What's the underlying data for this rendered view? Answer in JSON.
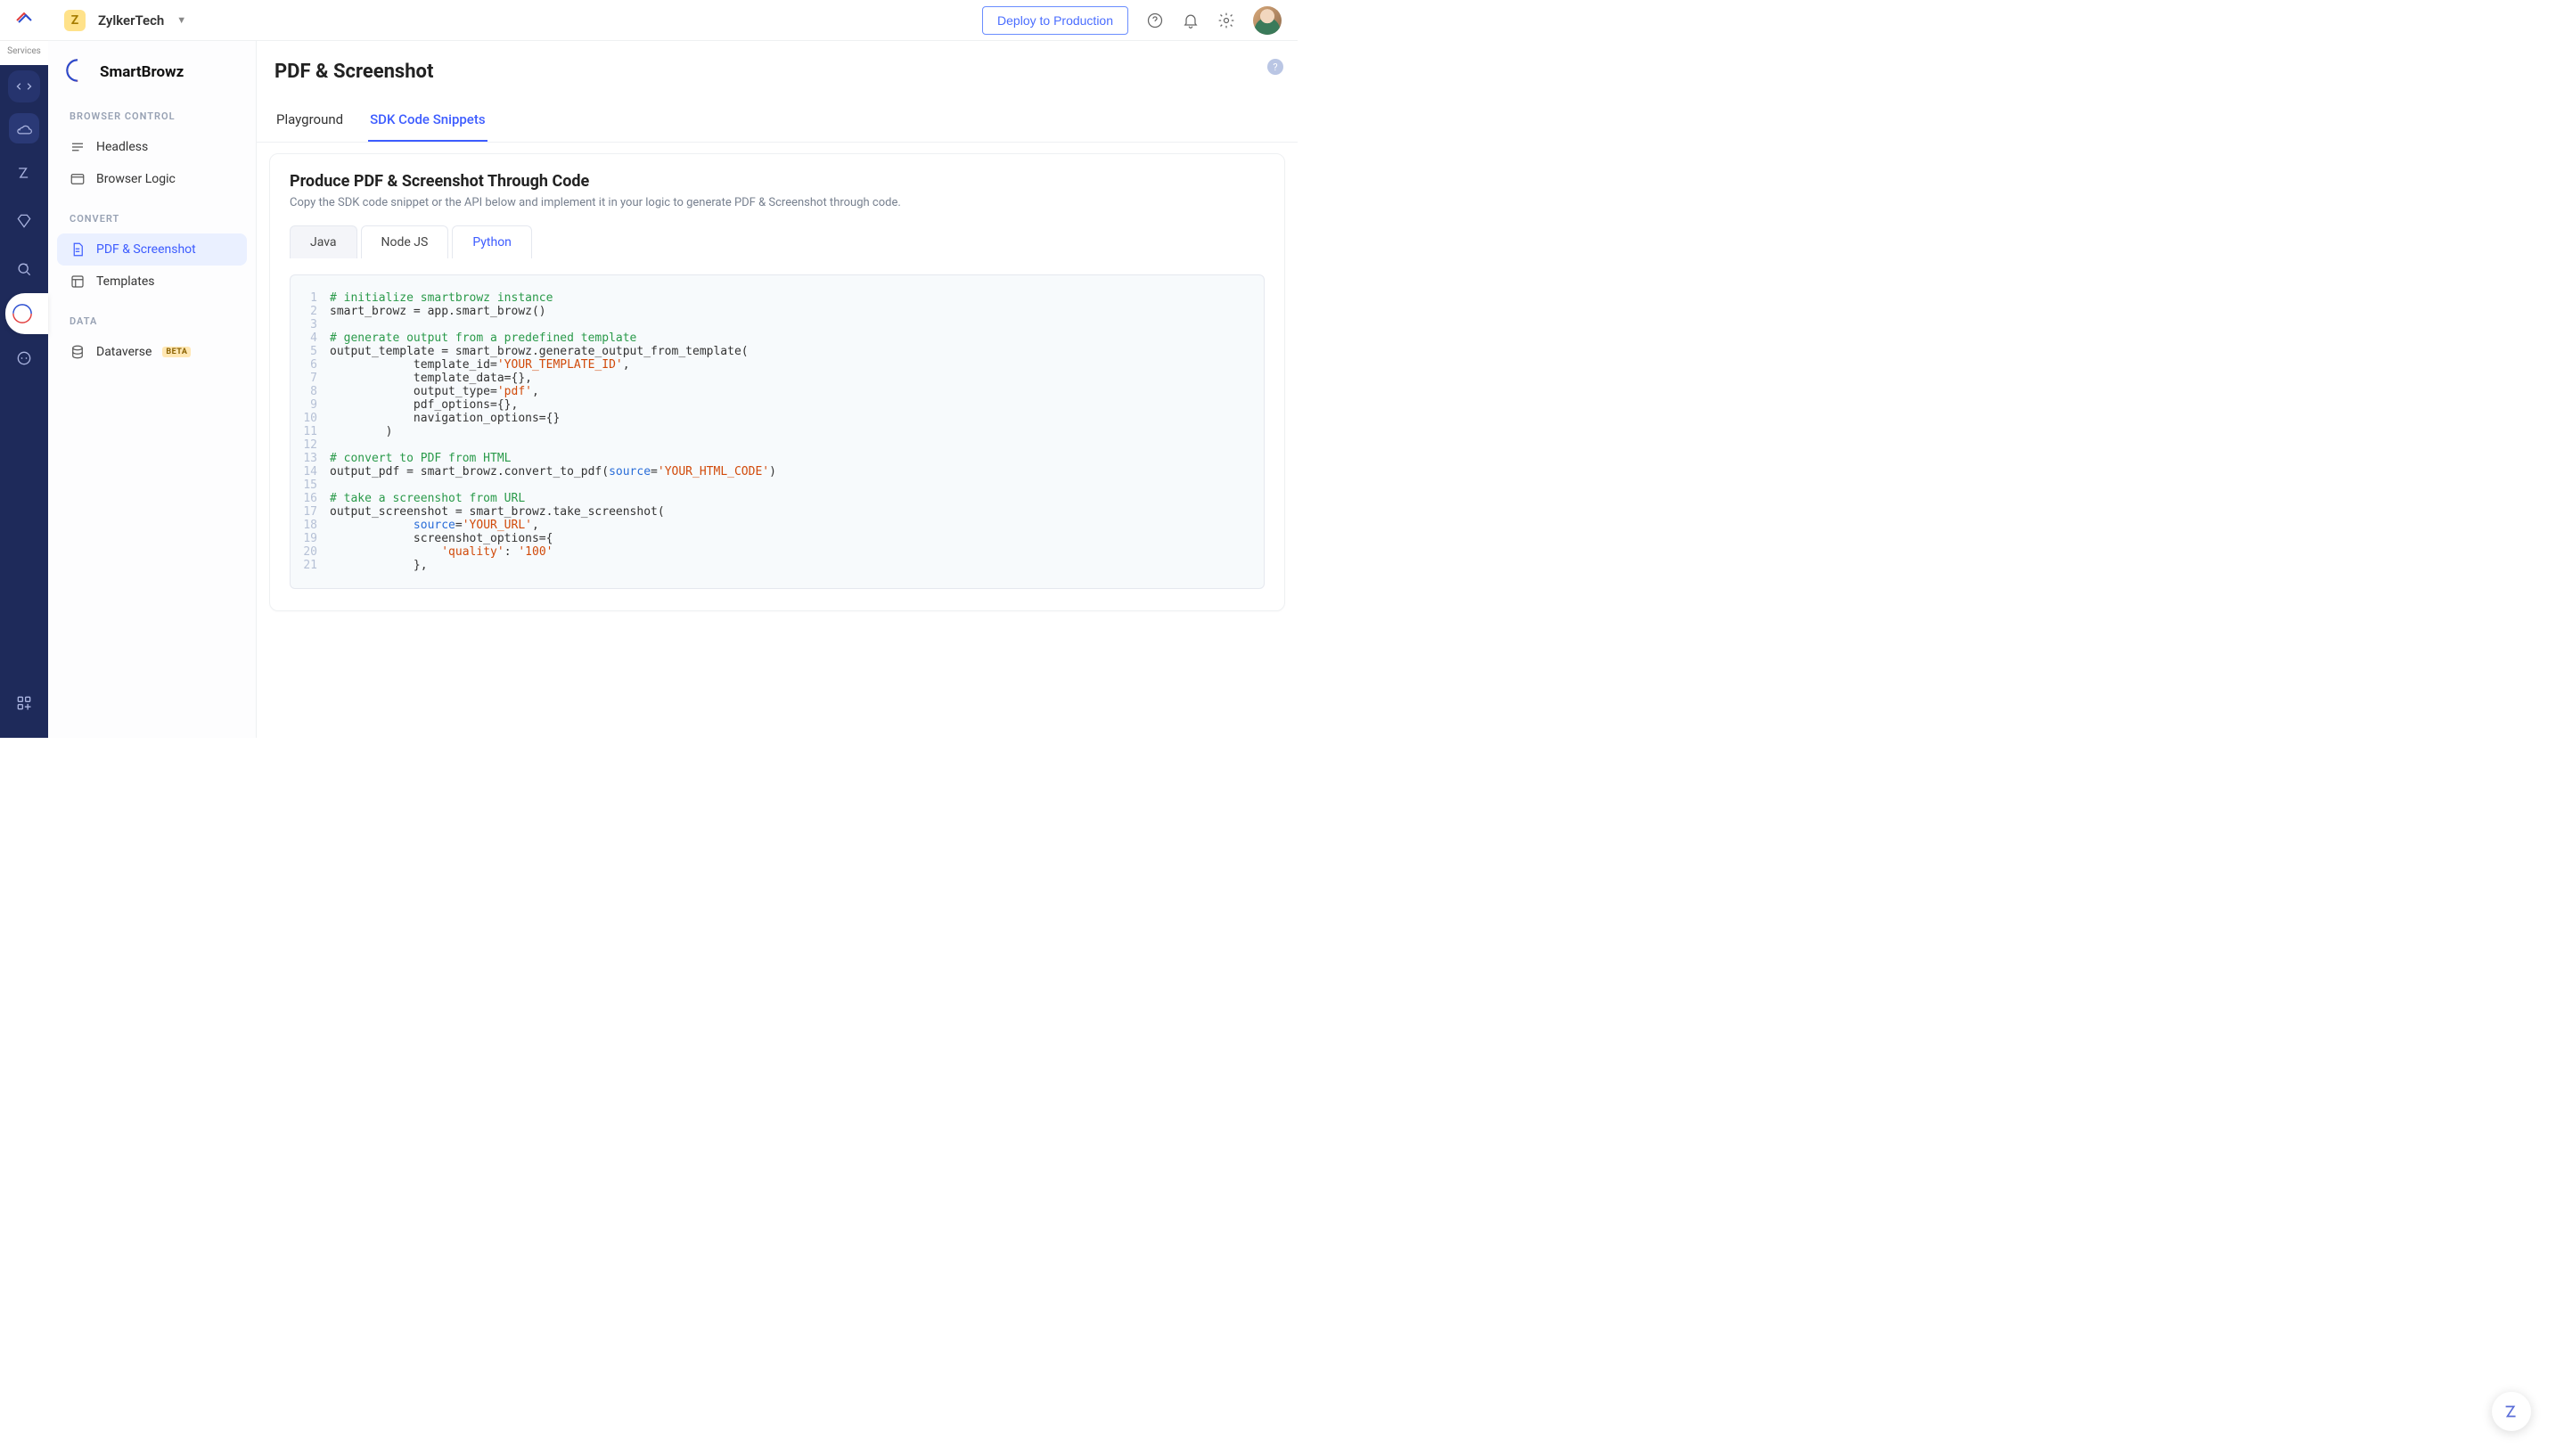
{
  "rail": {
    "services_label": "Services"
  },
  "topbar": {
    "org_initial": "Z",
    "org_name": "ZylkerTech",
    "deploy_label": "Deploy to Production"
  },
  "sidebar": {
    "product_title": "SmartBrowz",
    "groups": [
      {
        "label": "BROWSER CONTROL",
        "items": [
          {
            "label": "Headless"
          },
          {
            "label": "Browser Logic"
          }
        ]
      },
      {
        "label": "CONVERT",
        "items": [
          {
            "label": "PDF & Screenshot",
            "active": true
          },
          {
            "label": "Templates"
          }
        ]
      },
      {
        "label": "DATA",
        "items": [
          {
            "label": "Dataverse",
            "beta": "BETA"
          }
        ]
      }
    ]
  },
  "page": {
    "title": "PDF & Screenshot",
    "tabs": {
      "playground": "Playground",
      "sdk": "SDK Code Snippets",
      "active": "sdk"
    },
    "panel": {
      "heading": "Produce PDF & Screenshot Through Code",
      "sub": "Copy the SDK code snippet or the API below and implement it in your logic to generate PDF & Screenshot through code."
    },
    "lang_tabs": {
      "java": "Java",
      "node": "Node JS",
      "python": "Python",
      "active": "python"
    },
    "code": [
      {
        "n": 1,
        "segments": [
          {
            "t": "# initialize smartbrowz instance",
            "c": "comment"
          }
        ]
      },
      {
        "n": 2,
        "segments": [
          {
            "t": "smart_browz = app.smart_browz()"
          }
        ]
      },
      {
        "n": 3,
        "segments": [
          {
            "t": ""
          }
        ]
      },
      {
        "n": 4,
        "segments": [
          {
            "t": "# generate output from a predefined template",
            "c": "comment"
          }
        ]
      },
      {
        "n": 5,
        "segments": [
          {
            "t": "output_template = smart_browz.generate_output_from_template("
          }
        ]
      },
      {
        "n": 6,
        "segments": [
          {
            "t": "            template_id="
          },
          {
            "t": "'YOUR_TEMPLATE_ID'",
            "c": "str"
          },
          {
            "t": ","
          }
        ]
      },
      {
        "n": 7,
        "segments": [
          {
            "t": "            template_data={},"
          }
        ]
      },
      {
        "n": 8,
        "segments": [
          {
            "t": "            output_type="
          },
          {
            "t": "'pdf'",
            "c": "str"
          },
          {
            "t": ","
          }
        ]
      },
      {
        "n": 9,
        "segments": [
          {
            "t": "            pdf_options={},"
          }
        ]
      },
      {
        "n": 10,
        "segments": [
          {
            "t": "            navigation_options={}"
          }
        ]
      },
      {
        "n": 11,
        "segments": [
          {
            "t": "        )"
          }
        ]
      },
      {
        "n": 12,
        "segments": [
          {
            "t": ""
          }
        ]
      },
      {
        "n": 13,
        "segments": [
          {
            "t": "# convert to PDF from HTML",
            "c": "comment"
          }
        ]
      },
      {
        "n": 14,
        "segments": [
          {
            "t": "output_pdf = smart_browz.convert_to_pdf("
          },
          {
            "t": "source",
            "c": "kw"
          },
          {
            "t": "="
          },
          {
            "t": "'YOUR_HTML_CODE'",
            "c": "str"
          },
          {
            "t": ")"
          }
        ]
      },
      {
        "n": 15,
        "segments": [
          {
            "t": ""
          }
        ]
      },
      {
        "n": 16,
        "segments": [
          {
            "t": "# take a screenshot from URL",
            "c": "comment"
          }
        ]
      },
      {
        "n": 17,
        "segments": [
          {
            "t": "output_screenshot = smart_browz.take_screenshot("
          }
        ]
      },
      {
        "n": 18,
        "segments": [
          {
            "t": "            "
          },
          {
            "t": "source",
            "c": "kw"
          },
          {
            "t": "="
          },
          {
            "t": "'YOUR_URL'",
            "c": "str"
          },
          {
            "t": ","
          }
        ]
      },
      {
        "n": 19,
        "segments": [
          {
            "t": "            screenshot_options={"
          }
        ]
      },
      {
        "n": 20,
        "segments": [
          {
            "t": "                "
          },
          {
            "t": "'quality'",
            "c": "str"
          },
          {
            "t": ": "
          },
          {
            "t": "'100'",
            "c": "str"
          }
        ]
      },
      {
        "n": 21,
        "segments": [
          {
            "t": "            },"
          }
        ]
      }
    ]
  }
}
